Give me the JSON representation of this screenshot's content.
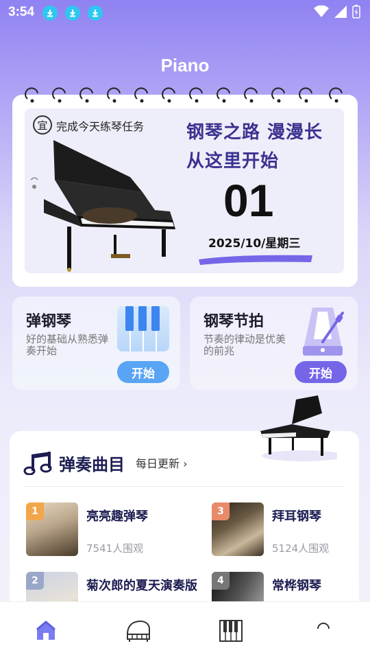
{
  "status": {
    "time": "3:54"
  },
  "page": {
    "title": "Piano"
  },
  "calendar": {
    "badge": "宜",
    "task": "完成今天练琴任务",
    "slogan_line1": "钢琴之路 漫漫长",
    "slogan_line2": "从这里开始",
    "day": "01",
    "date": "2025/10/星期三"
  },
  "features": [
    {
      "title": "弹钢琴",
      "desc": "好的基础从熟悉弹奏开始",
      "button": "开始"
    },
    {
      "title": "钢琴节拍",
      "desc": "节奏的律动是优美的前兆",
      "button": "开始"
    }
  ],
  "songs": {
    "title": "弹奏曲目",
    "subtitle": "每日更新",
    "items": [
      {
        "rank": "1",
        "name": "亮亮趣弹琴",
        "views": "7541人围观",
        "rank_color": "#f2a64a"
      },
      {
        "rank": "3",
        "name": "拜耳钢琴",
        "views": "5124人围观",
        "rank_color": "#e88a6a"
      },
      {
        "rank": "2",
        "name": "菊次郎的夏天演奏版",
        "views": "",
        "rank_color": "#9aa7c8"
      },
      {
        "rank": "4",
        "name": "常桦钢琴",
        "views": "",
        "rank_color": "#888"
      }
    ]
  },
  "colors": {
    "accent": "#7566e8",
    "blue_button": "#59a4f4",
    "title_navy": "#1c1c52"
  }
}
